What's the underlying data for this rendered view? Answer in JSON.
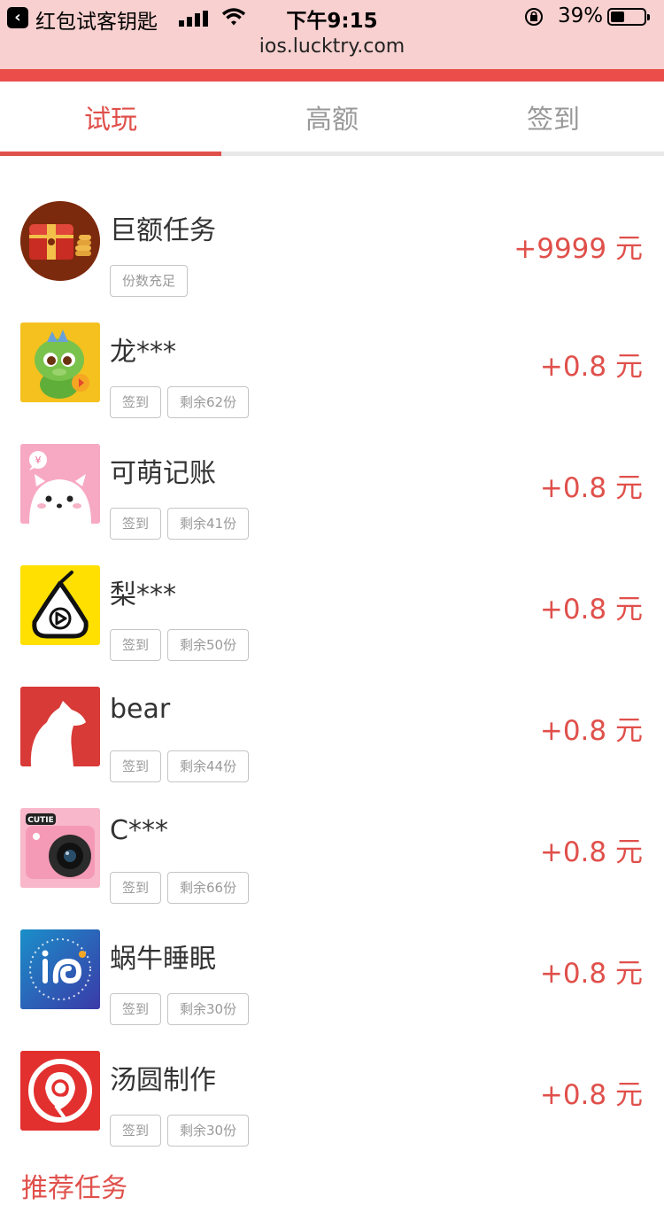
{
  "status_bar": {
    "back_app": "红包试客钥匙",
    "time": "下午9:15",
    "battery": "39%",
    "url": "ios.lucktry.com"
  },
  "tabs": [
    {
      "label": "试玩",
      "active": true
    },
    {
      "label": "高额",
      "active": false
    },
    {
      "label": "签到",
      "active": false
    }
  ],
  "tasks": [
    {
      "name": "巨额任务",
      "tags": [
        "份数充足"
      ],
      "reward": "+9999 元",
      "icon": "treasure-chest-icon"
    },
    {
      "name": "龙***",
      "tags": [
        "签到",
        "剩余62份"
      ],
      "reward": "+0.8 元",
      "icon": "dragon-icon"
    },
    {
      "name": "可萌记账",
      "tags": [
        "签到",
        "剩余41份"
      ],
      "reward": "+0.8 元",
      "icon": "cute-cat-icon"
    },
    {
      "name": "梨***",
      "tags": [
        "签到",
        "剩余50份"
      ],
      "reward": "+0.8 元",
      "icon": "pear-play-icon"
    },
    {
      "name": "bear",
      "tags": [
        "签到",
        "剩余44份"
      ],
      "reward": "+0.8 元",
      "icon": "bear-icon"
    },
    {
      "name": "C***",
      "tags": [
        "签到",
        "剩余66份"
      ],
      "reward": "+0.8 元",
      "icon": "camera-icon"
    },
    {
      "name": "蜗牛睡眠",
      "tags": [
        "签到",
        "剩余30份"
      ],
      "reward": "+0.8 元",
      "icon": "snail-sleep-icon"
    },
    {
      "name": "汤圆制作",
      "tags": [
        "签到",
        "剩余30份"
      ],
      "reward": "+0.8 元",
      "icon": "tangyuan-icon"
    }
  ],
  "section": {
    "title": "推荐任务"
  },
  "icon_labels": {
    "camera": "CUTIE",
    "cat_bubble": "¥"
  },
  "colors": {
    "accent": "#e0504b",
    "status_bg": "#f7d0cf",
    "bar_red": "#ea4d4a"
  }
}
